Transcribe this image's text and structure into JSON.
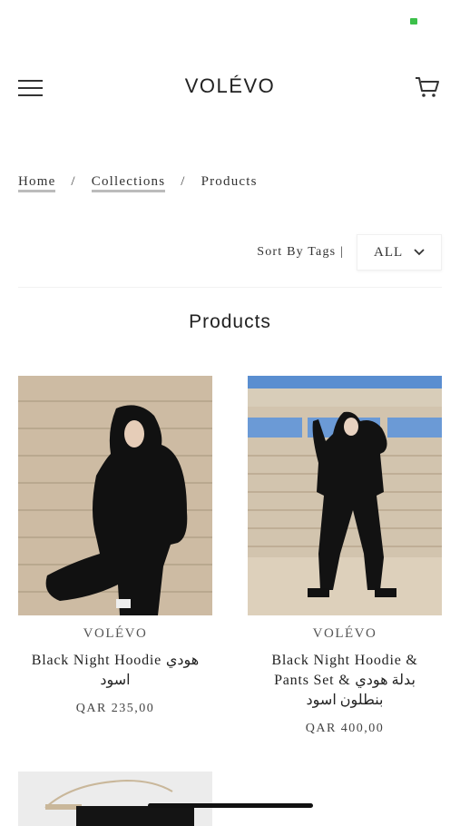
{
  "colors": {
    "status_indicator": "#3cc04a",
    "text": "#222222",
    "underline": "#bbbbbb"
  },
  "header": {
    "menu_icon": "hamburger-menu-icon",
    "logo": "VOLÉVO",
    "cart_icon": "shopping-cart-icon"
  },
  "breadcrumb": {
    "items": [
      "Home",
      "Collections",
      "Products"
    ],
    "separator": "/"
  },
  "sort": {
    "label": "Sort By Tags |",
    "selected": "ALL",
    "icon": "chevron-down-icon"
  },
  "page_title": "Products",
  "products": [
    {
      "vendor": "VOLÉVO",
      "title": "Black Night Hoodie هودي اسود",
      "price": "QAR 235,00"
    },
    {
      "vendor": "VOLÉVO",
      "title": "Black Night Hoodie & Pants Set & بدلة هودي بنطلون اسود",
      "price": "QAR 400,00"
    }
  ]
}
